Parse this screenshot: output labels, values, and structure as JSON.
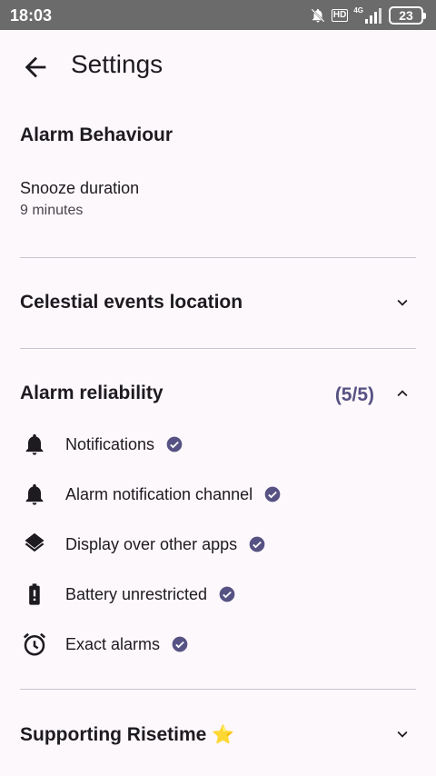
{
  "status_bar": {
    "time": "18:03",
    "hd": "HD",
    "network": "4G",
    "battery": "23"
  },
  "app_bar": {
    "title": "Settings"
  },
  "alarm_behaviour": {
    "header": "Alarm Behaviour",
    "snooze_title": "Snooze duration",
    "snooze_value": "9 minutes"
  },
  "celestial": {
    "header": "Celestial events location"
  },
  "reliability": {
    "header": "Alarm reliability",
    "count": "(5/5)",
    "items": [
      {
        "label": "Notifications",
        "icon": "bell-icon"
      },
      {
        "label": "Alarm notification channel",
        "icon": "bell-icon"
      },
      {
        "label": "Display over other apps",
        "icon": "layers-icon"
      },
      {
        "label": "Battery unrestricted",
        "icon": "battery-alert-icon"
      },
      {
        "label": "Exact alarms",
        "icon": "alarm-clock-icon"
      }
    ]
  },
  "supporting": {
    "header": "Supporting Risetime",
    "emoji": "⭐"
  },
  "colors": {
    "accent": "#565283",
    "background": "#fdf8fc",
    "status_bar": "#6b6b6b"
  }
}
